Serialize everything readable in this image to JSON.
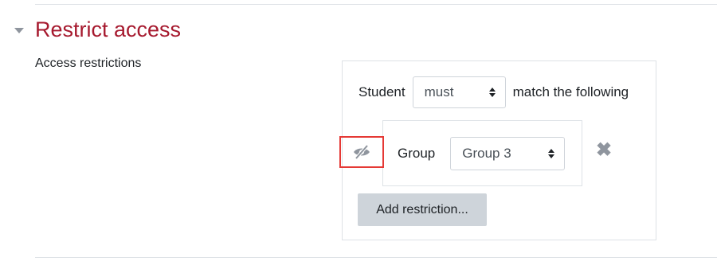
{
  "section": {
    "title": "Restrict access",
    "collapse_icon": "caret-down-icon"
  },
  "field": {
    "label": "Access restrictions"
  },
  "restriction": {
    "lead_label": "Student",
    "match_select_value": "must",
    "trail_label": "match the following",
    "visibility_icon": "eye-slash-icon",
    "condition": {
      "type_label": "Group",
      "group_select_value": "Group 3"
    },
    "remove_icon": "close-icon",
    "remove_glyph": "✖",
    "add_button_label": "Add restriction..."
  },
  "colors": {
    "section_title": "#a6192e",
    "highlight": "#e53935",
    "button_bg": "#ced4da"
  }
}
